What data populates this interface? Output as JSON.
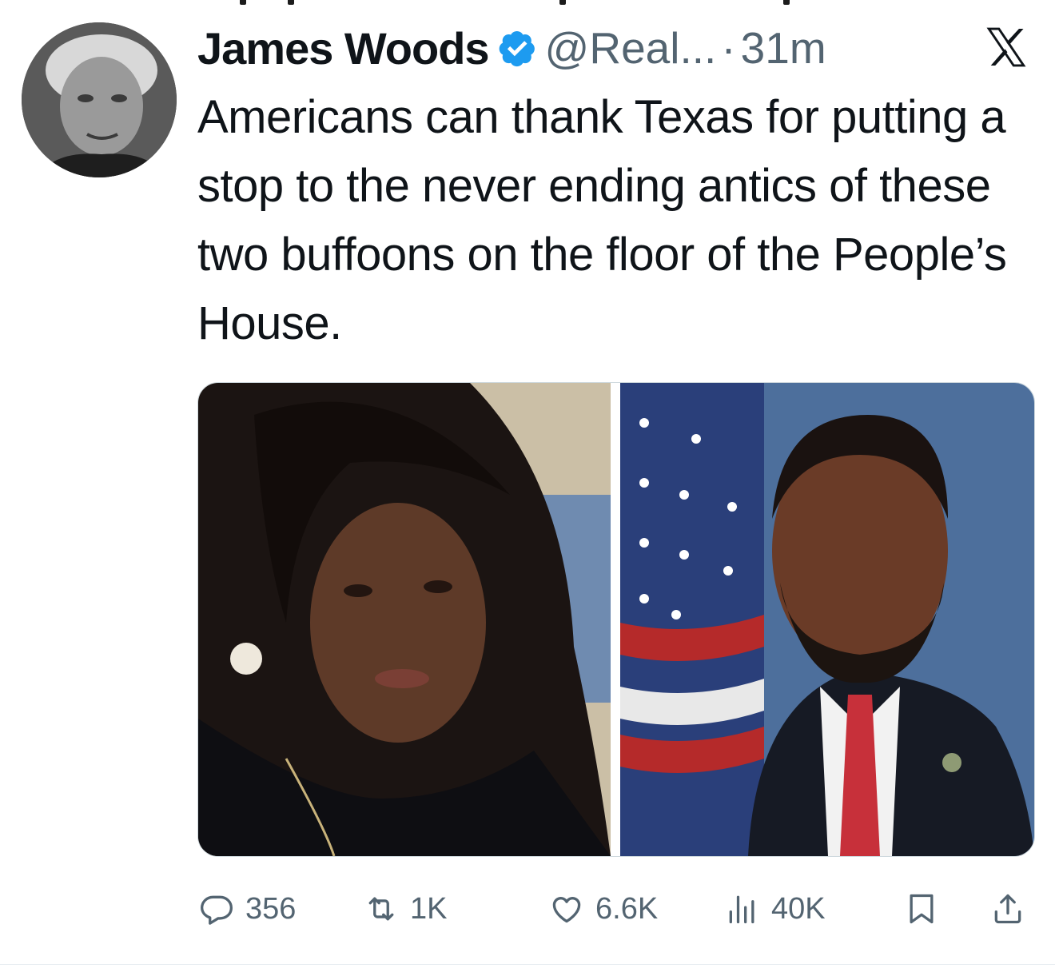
{
  "tweet": {
    "author_name": "James Woods",
    "handle": "@Real...",
    "separator": "·",
    "time": "31m",
    "text": "Americans can thank Texas for putting a stop to the never ending antics of these two buffoons on the floor of the People’s House.",
    "verified": true,
    "platform_logo": "x-logo-icon"
  },
  "stats": {
    "replies": "356",
    "reposts": "1K",
    "likes": "6.6K",
    "views": "40K"
  },
  "icons": {
    "reply": "comment-icon",
    "repost": "repost-icon",
    "like": "heart-icon",
    "views": "views-chart-icon",
    "bookmark": "bookmark-icon",
    "share": "share-icon"
  },
  "colors": {
    "verified_blue": "#1d9bf0",
    "secondary_text": "#536471",
    "primary_text": "#0f1419"
  }
}
